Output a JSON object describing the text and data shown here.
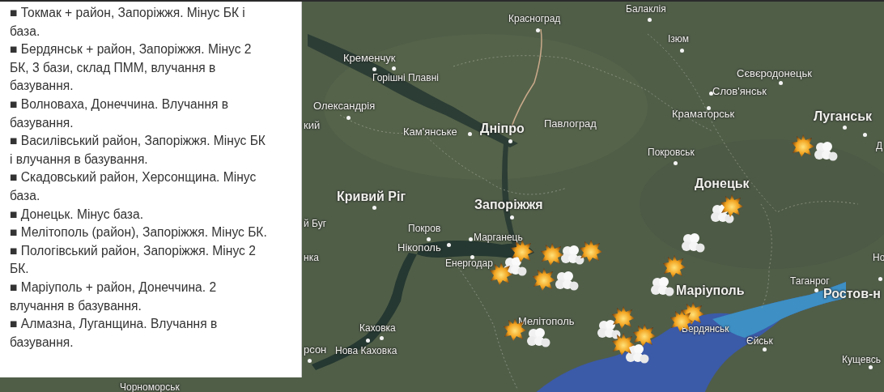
{
  "report_panel": {
    "items": [
      "■ Токмак + район, Запоріжжя. Мінус БК і база.",
      "■ Бердянськ + район, Запоріжжя. Мінус 2 БК, 3 бази, склад ПММ, влучання в базування.",
      "■ Волноваха, Донеччина. Влучання в базування.",
      "■ Василівський район, Запоріжжя. Мінус БК і влучання в базування.",
      "■ Скадовський район, Херсонщина. Мінус база.",
      "■ Донецьк. Мінус база.",
      "■ Мелітополь (район), Запоріжжя. Мінус БК.",
      "■ Пологівський район, Запоріжжя. Мінус 2 БК.",
      "■ Маріуполь + район, Донеччина. 2 влучання в базування.",
      "■ Алмазна, Луганщина. Влучання в базування."
    ]
  },
  "map": {
    "labels": [
      {
        "text": "Балаклія",
        "kind": "town"
      },
      {
        "text": "Красноград",
        "kind": "town"
      },
      {
        "text": "Ізюм",
        "kind": "town"
      },
      {
        "text": "Кременчук",
        "kind": "city"
      },
      {
        "text": "Горішні Плавні",
        "kind": "town"
      },
      {
        "text": "Сєвєродонецьк",
        "kind": "city"
      },
      {
        "text": "Олександрія",
        "kind": "city"
      },
      {
        "text": "Слов'янськ",
        "kind": "city"
      },
      {
        "text": "кий",
        "kind": "city"
      },
      {
        "text": "Краматорськ",
        "kind": "city"
      },
      {
        "text": "Луганськ",
        "kind": "major"
      },
      {
        "text": "Кам'янське",
        "kind": "city"
      },
      {
        "text": "Дніпро",
        "kind": "major"
      },
      {
        "text": "Павлоград",
        "kind": "city"
      },
      {
        "text": "Д",
        "kind": "town"
      },
      {
        "text": "Покровськ",
        "kind": "town"
      },
      {
        "text": "Донецьк",
        "kind": "major"
      },
      {
        "text": "Кривий Ріг",
        "kind": "major"
      },
      {
        "text": "Запоріжжя",
        "kind": "major"
      },
      {
        "text": "й Буг",
        "kind": "town"
      },
      {
        "text": "Покров",
        "kind": "town"
      },
      {
        "text": "Марганець",
        "kind": "town"
      },
      {
        "text": "Нікополь",
        "kind": "city"
      },
      {
        "text": "нка",
        "kind": "town"
      },
      {
        "text": "Енергодар",
        "kind": "town"
      },
      {
        "text": "Но",
        "kind": "town"
      },
      {
        "text": "Таганрог",
        "kind": "town"
      },
      {
        "text": "Ростов-н",
        "kind": "major"
      },
      {
        "text": "Маріуполь",
        "kind": "major"
      },
      {
        "text": "Мелітополь",
        "kind": "city"
      },
      {
        "text": "Каховка",
        "kind": "town"
      },
      {
        "text": "Бердянськ",
        "kind": "town"
      },
      {
        "text": "Єйськ",
        "kind": "town"
      },
      {
        "text": "рсон",
        "kind": "city"
      },
      {
        "text": "Нова Каховка",
        "kind": "town"
      },
      {
        "text": "Кущевсь",
        "kind": "town"
      },
      {
        "text": "Чорноморськ",
        "kind": "town"
      }
    ]
  }
}
